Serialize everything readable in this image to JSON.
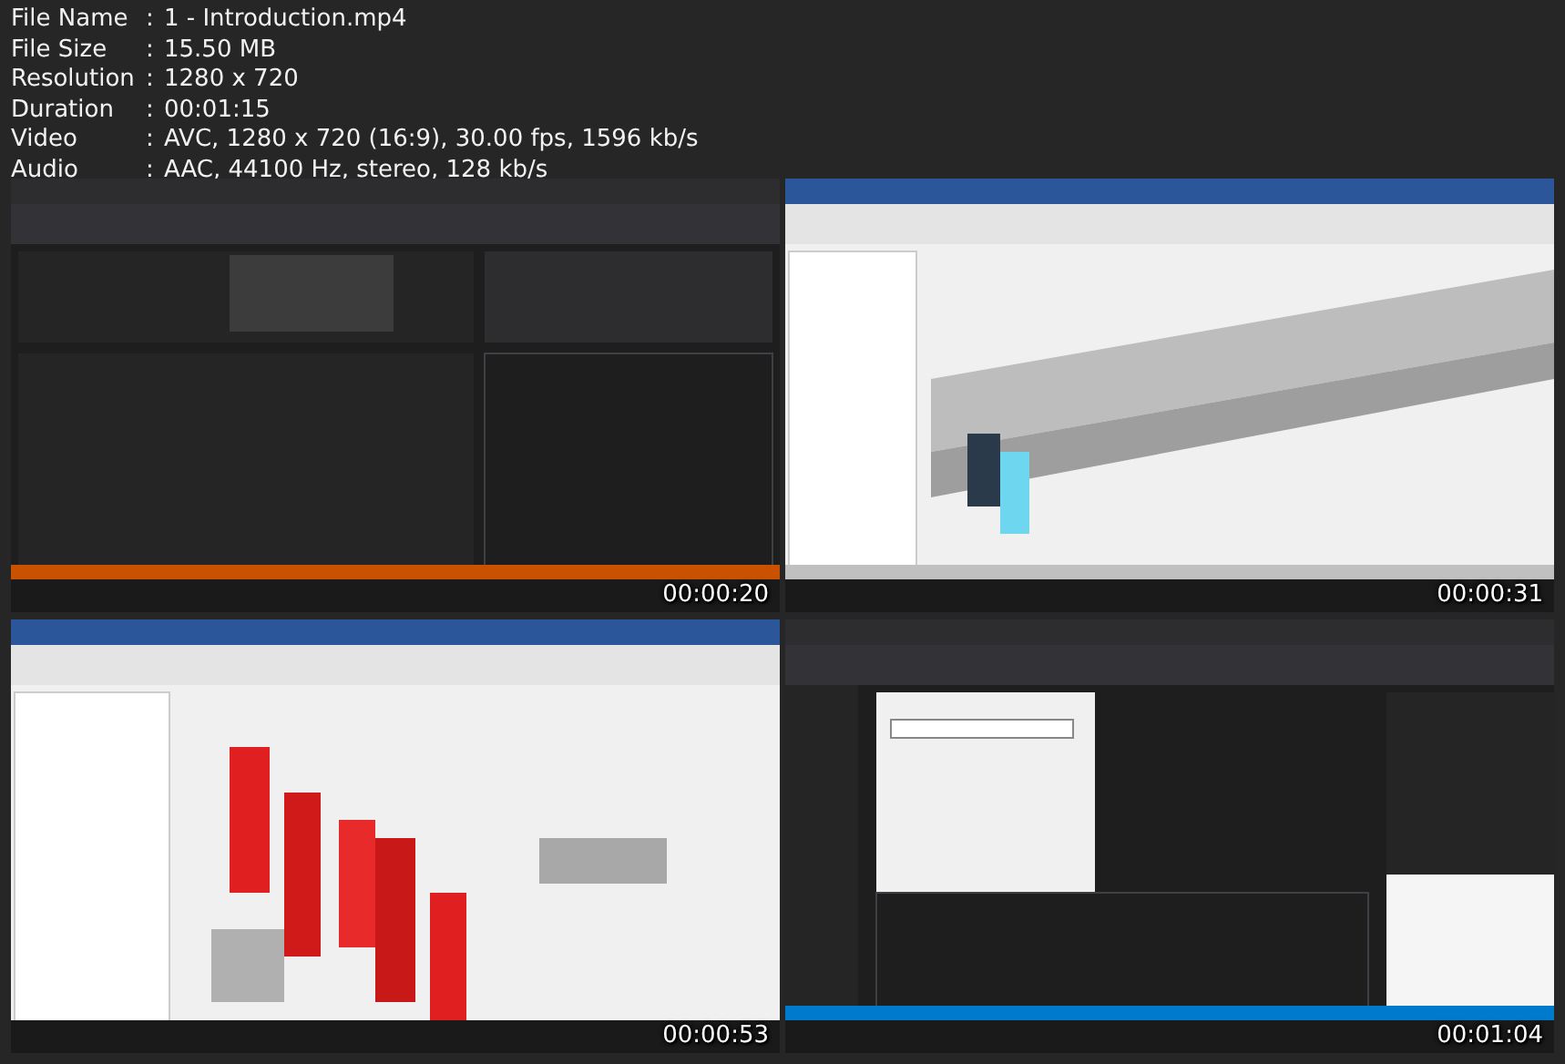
{
  "info": [
    {
      "label": "File Name",
      "separator": ":",
      "value": "1 - Introduction.mp4"
    },
    {
      "label": "File Size",
      "separator": ":",
      "value": "15.50 MB"
    },
    {
      "label": "Resolution",
      "separator": ":",
      "value": "1280 x 720"
    },
    {
      "label": "Duration",
      "separator": ":",
      "value": "00:01:15"
    },
    {
      "label": "Video",
      "separator": ":",
      "value": "AVC, 1280 x 720 (16:9), 30.00 fps, 1596 kb/s"
    },
    {
      "label": "Audio",
      "separator": ":",
      "value": "AAC, 44100 Hz, stereo, 128 kb/s"
    }
  ],
  "frames": [
    {
      "timestamp": "00:00:20"
    },
    {
      "timestamp": "00:00:31"
    },
    {
      "timestamp": "00:00:53"
    },
    {
      "timestamp": "00:01:04"
    }
  ]
}
